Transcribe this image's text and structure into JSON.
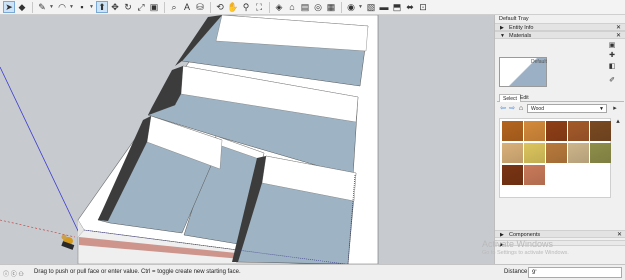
{
  "toolbar": {
    "icons": [
      "select-icon",
      "eraser-icon",
      "line-icon",
      "arc-icon",
      "rectangle-icon",
      "push-pull-icon",
      "move-icon",
      "rotate-icon",
      "scale-icon",
      "offset-icon",
      "tape-measure-icon",
      "text-icon",
      "paint-bucket-icon",
      "orbit-icon",
      "pan-icon",
      "zoom-icon",
      "zoom-extents-icon",
      "section-icon",
      "warehouse-icon",
      "extension-icon",
      "geo-location-icon",
      "sandbox-icon",
      "view-icon",
      "style-icon"
    ]
  },
  "tray": {
    "title": "Default Tray",
    "entity_info": "Entity Info",
    "materials": "Materials",
    "material_name": "Default",
    "tabs": [
      "Select",
      "Edit"
    ],
    "library": "Wood",
    "components": "Components"
  },
  "swatches": [
    "#b4651f",
    "#d48a3b",
    "#8f3f17",
    "#a45a2a",
    "#7a4a22",
    "#d9b079",
    "#dcc55e",
    "#b87a3c",
    "#cdb58b",
    "#8e8f4a",
    "#7a3414",
    "#c97a5a"
  ],
  "watermark": {
    "title": "Activate Windows",
    "subtitle": "Go to Settings to activate Windows."
  },
  "status": {
    "message": "Drag to push or pull face or enter value.  Ctrl = toggle create new starting face.",
    "distance_label": "Distance",
    "distance_value": "9'"
  },
  "colors": {
    "viewport_bg": "#c7cbcf",
    "floor": "#9eb3c3",
    "wall_top": "#ffffff",
    "wall_shadow": "#5a5a5a"
  }
}
